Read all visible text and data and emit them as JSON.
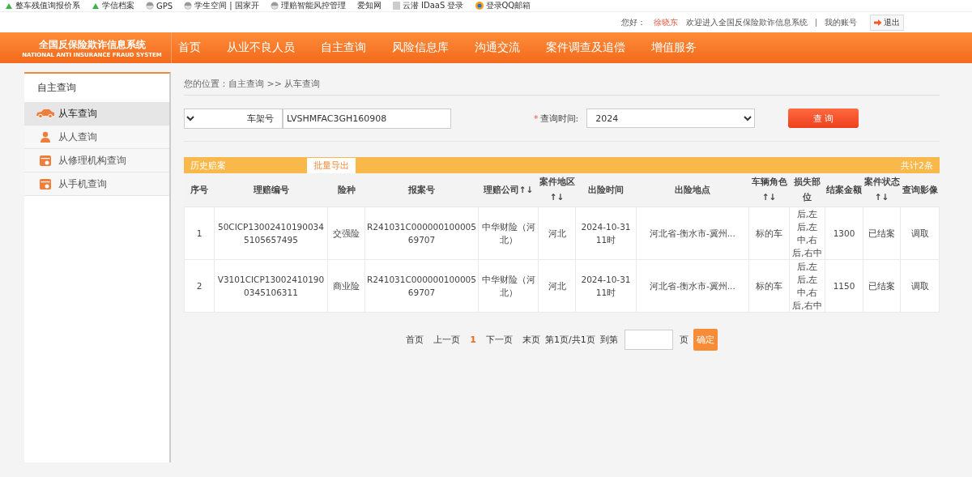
{
  "bookmarks": [
    {
      "label": "整车残值询报价系",
      "kind": "leaf"
    },
    {
      "label": "学信档案",
      "kind": "leaf"
    },
    {
      "label": "GPS",
      "kind": "globe"
    },
    {
      "label": "学生空间 | 国家开",
      "kind": "globe"
    },
    {
      "label": "理赔智能风控管理",
      "kind": "globe"
    },
    {
      "label": "爱知网",
      "kind": "plain"
    },
    {
      "label": "云潜 IDaaS 登录",
      "kind": "page"
    },
    {
      "label": "登录QQ邮箱",
      "kind": "mail"
    }
  ],
  "topbar": {
    "greeting": "您好：",
    "user": "徐晓东",
    "welcome": "欢迎进入全国反保险欺诈信息系统",
    "account": "我的账号",
    "logout": "退出"
  },
  "logo": {
    "title": "全国反保险欺诈信息系统",
    "subtitle": "NATIONAL ANTI INSURANCE FRAUD SYSTEM"
  },
  "nav": [
    "首页",
    "从业不良人员",
    "自主查询",
    "风险信息库",
    "沟通交流",
    "案件调查及追偿",
    "增值服务"
  ],
  "sidebar": {
    "title": "自主查询",
    "items": [
      {
        "label": "从车查询",
        "kind": "car",
        "selected": true
      },
      {
        "label": "从人查询",
        "kind": "person",
        "selected": false
      },
      {
        "label": "从修理机构查询",
        "kind": "card",
        "selected": false
      },
      {
        "label": "从手机查询",
        "kind": "card",
        "selected": false
      }
    ]
  },
  "breadcrumb": "您的位置：自主查询 >> 从车查询",
  "search": {
    "field_type": "车架号",
    "value": "LVSHMFAC3GH160908",
    "required_mark": "*",
    "time_label": "查询时间:",
    "time_value": "2024",
    "button": "查 询"
  },
  "results": {
    "title": "历史赔案",
    "export": "批量导出",
    "total": "共计2条",
    "columns": [
      "序号",
      "理赔编号",
      "险种",
      "报案号",
      "理赔公司↑↓",
      "案件地区↑↓",
      "出险时间",
      "出险地点",
      "车辆角色↑↓",
      "损失部位",
      "结案金额",
      "案件状态↑↓",
      "查询影像"
    ],
    "rows": [
      [
        "1",
        "50CICP130024101900345105657495",
        "交强险",
        "R241031C00000010000569707",
        "中华财险（河北）",
        "河北",
        "2024-10-31 11时",
        "河北省-衡水市-冀州...",
        "标的车",
        "后,左后,左中,右后,右中",
        "1300",
        "已结案",
        "调取"
      ],
      [
        "2",
        "V3101CICP130024101900345106311",
        "商业险",
        "R241031C00000010000569707",
        "中华财险（河北）",
        "河北",
        "2024-10-31 11时",
        "河北省-衡水市-冀州...",
        "标的车",
        "后,左后,左中,右后,右中",
        "1150",
        "已结案",
        "调取"
      ]
    ]
  },
  "pagination": {
    "first": "首页",
    "prev": "上一页",
    "current": "1",
    "next": "下一页",
    "last": "末页",
    "info": "第1页/共1页",
    "goto": "到第",
    "page_unit": "页",
    "confirm": "确定"
  }
}
